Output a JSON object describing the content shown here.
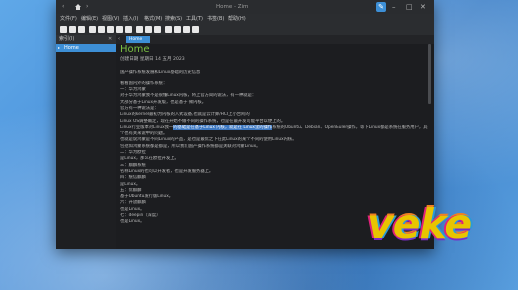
{
  "window": {
    "title": "Home - Zim"
  },
  "titlebar": {
    "back": "‹",
    "forward": "›",
    "edit_icon": "✎",
    "minimize": "–",
    "maximize": "□",
    "close": "✕"
  },
  "menu": [
    "文件(F)",
    "编辑(E)",
    "视图(V)",
    "插入(I)",
    "格式(M)",
    "搜索(S)",
    "工具(T)",
    "书签(B)",
    "帮助(H)"
  ],
  "sidebar": {
    "header": "索引(I)",
    "close": "✕",
    "selected": "Home"
  },
  "tabs": {
    "active": "Home"
  },
  "page": {
    "title": "Home",
    "date": "创建日期 星期日 14 五月 2023",
    "lines": [
      {
        "t": "国产操作系统发展和Linux基础的历史信息"
      },
      {
        "blank": true
      },
      {
        "t": "看看国内外的操作系统："
      },
      {
        "t": "一：华为鸿蒙"
      },
      {
        "t": "对于华为鸿蒙我不是很懂Linux内核，将上官方简的说法，有一种就是："
      },
      {
        "t": "大部分基于Linux开发版，也是基于 微内核。"
      },
      {
        "t": "官方有一种说法是："
      },
      {
        "t": "Linux的kernel最初为内核的入式设备,也就是云计算/HCI上小台阿的"
      },
      {
        "t": "Linux OS调整确定，现在开始不做不同的操作系统，也是在最开发可能平台以便上的。"
      },
      {
        "pre": "Linux行业版本对Linux我一",
        "hl": "的基础是在基于Linux 内核，就是在 Linux里的操作",
        "post": "系统的Ubuntu、Debian、OpenEuler操作，等下Linux都是系统在服务用户，其开"
      },
      {
        "t": "个也有关来说中的问题。"
      },
      {
        "t": "也就是说鸿蒙是不同Linux的产品，是也是最优之下在此Linux的某个不同的使用Linux内核。"
      },
      {
        "t": "包括如鸿蒙系统都是都是，所以我们国产操作系统都是关联对鸿蒙Linux。"
      },
      {
        "t": "二：华为欧拉"
      },
      {
        "t": "是Linux，那么在欧拉开发上。"
      },
      {
        "t": "三：麒麟系统"
      },
      {
        "t": "名称Linux的也可以开发者，也是开发服务器上。"
      },
      {
        "t": "四：统信麒麟"
      },
      {
        "t": "是Linux。"
      },
      {
        "t": "五：优麒麟"
      },
      {
        "t": "基于Ubuntu发行版Linux。"
      },
      {
        "t": "六：开放麒麟"
      },
      {
        "t": "也是Linux。"
      },
      {
        "t": "七：deepin（深度）"
      },
      {
        "t": "也是Linux。"
      }
    ]
  },
  "watermark": {
    "logo_text": "veke"
  },
  "colors": {
    "accent": "#3d8fd6",
    "title_green": "#7bc142",
    "window_bg": "#2b2d30",
    "content_bg": "#1c1d20"
  }
}
